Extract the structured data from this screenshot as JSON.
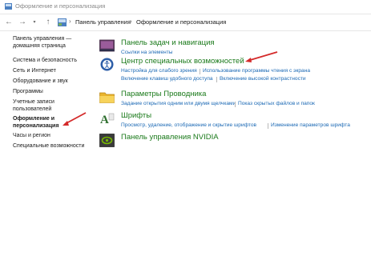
{
  "window": {
    "title": "Оформление и персонализация"
  },
  "nav": {
    "breadcrumb": [
      "Панель управления",
      "Оформление и персонализация"
    ]
  },
  "sidebar": {
    "items": [
      {
        "lines": [
          "Панель управления —",
          "домашняя страница"
        ]
      },
      {
        "lines": [
          "Система и безопасность"
        ]
      },
      {
        "lines": [
          "Сеть и Интернет"
        ]
      },
      {
        "lines": [
          "Оборудование и звук"
        ]
      },
      {
        "lines": [
          "Программы"
        ]
      },
      {
        "lines": [
          "Учетные записи",
          "пользователей"
        ]
      },
      {
        "lines": [
          "Оформление и",
          "персонализация"
        ]
      },
      {
        "lines": [
          "Часы и регион"
        ]
      },
      {
        "lines": [
          "Специальные возможности"
        ]
      }
    ]
  },
  "main": {
    "sections": [
      {
        "title": "Панель задач и навигация",
        "icon": "taskbar-icon",
        "links": [
          "Ссылки на элементы"
        ]
      },
      {
        "title": "Центр специальных возможностей",
        "icon": "ease-of-access-icon",
        "links": [
          "Настройка для слабого зрения",
          "Использование программы чтения с экрана",
          "Включение клавиш удобного доступа",
          "Включение высокой контрастности"
        ]
      },
      {
        "title": "Параметры Проводника",
        "icon": "folder-options-icon",
        "links": [
          "Задание открытия одним или двумя щелчками",
          "Показ скрытых файлов и папок"
        ]
      },
      {
        "title": "Шрифты",
        "icon": "fonts-icon",
        "links": [
          "Просмотр, удаление, отображение и скрытие шрифтов",
          "Изменение параметров шрифта"
        ]
      },
      {
        "title": "Панель управления NVIDIA",
        "icon": "nvidia-icon",
        "links": []
      }
    ]
  },
  "colors": {
    "section_title": "#1b7a1b",
    "link": "#1a68b4",
    "arrow": "#d42a2a"
  }
}
